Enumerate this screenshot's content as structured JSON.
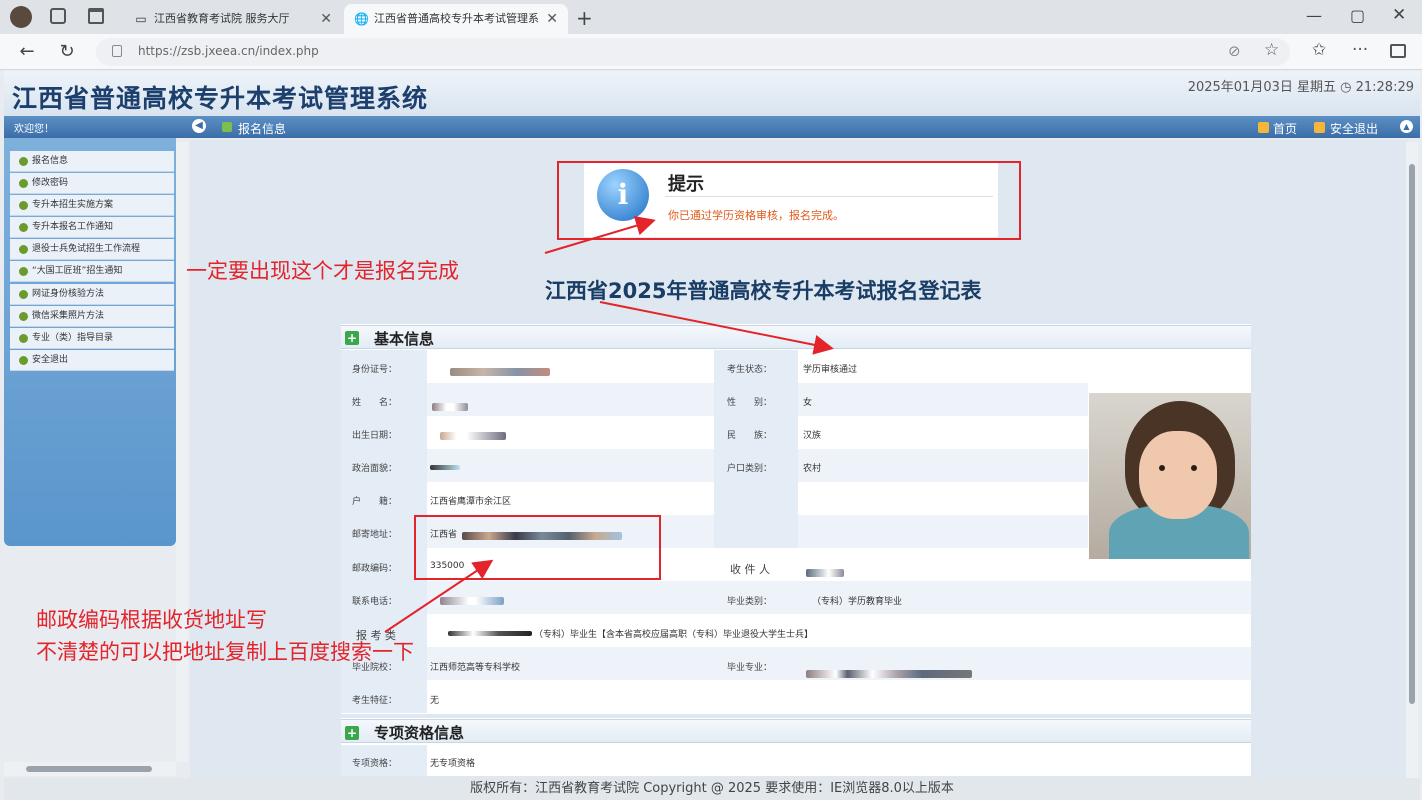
{
  "browser": {
    "tabs": [
      {
        "title": "江西省教育考试院 服务大厅",
        "active": false
      },
      {
        "title": "江西省普通高校专升本考试管理系",
        "active": true
      }
    ],
    "url": "https://zsb.jxeea.cn/index.php"
  },
  "header": {
    "title": "江西省普通高校专升本考试管理系统",
    "datetime": "2025年01月03日 星期五 ◷ 21:28:29"
  },
  "navbar": {
    "welcome": "欢迎您！",
    "breadcrumb": "报名信息",
    "home": "首页",
    "logout": "安全退出"
  },
  "sidebar": {
    "items": [
      {
        "label": "报名信息"
      },
      {
        "label": "修改密码"
      },
      {
        "label": "专升本招生实施方案"
      },
      {
        "label": "专升本报名工作通知"
      },
      {
        "label": "退役士兵免试招生工作流程"
      },
      {
        "label": "“大国工匠班”招生通知"
      },
      {
        "label": "网证身份核验方法"
      },
      {
        "label": "微信采集照片方法"
      },
      {
        "label": "专业（类）指导目录"
      },
      {
        "label": "安全退出"
      }
    ]
  },
  "notice": {
    "title": "提示",
    "message": "你已通过学历资格审核，报名完成。"
  },
  "annotations": {
    "notice": "一定要出现这个才是报名完成",
    "postal_line1": "邮政编码根据收货地址写",
    "postal_line2": "不清楚的可以把地址复制上百度搜索一下"
  },
  "form": {
    "title": "江西省2025年普通高校专升本考试报名登记表",
    "section_basic": "基本信息",
    "section_special": "专项资格信息",
    "labels": {
      "id_no": "身份证号：",
      "status": "考生状态：",
      "name": "姓　　名：",
      "gender": "性　　别：",
      "birth": "出生日期：",
      "ethnicity": "民　　族：",
      "politics": "政治面貌：",
      "hukou_type": "户口类别：",
      "hukou": "户　　籍：",
      "mail_addr": "邮寄地址：",
      "postal": "邮政编码：",
      "receiver": "收 件 人",
      "phone": "联系电话：",
      "grad_type": "毕业类别：",
      "type": "报 考 类",
      "school": "毕业院校：",
      "major": "毕业专业：",
      "feature": "考生特征：",
      "special": "专项资格："
    },
    "values": {
      "status": "学历审核通过",
      "gender": "女",
      "ethnicity": "汉族",
      "hukou_type": "农村",
      "hukou": "江西省鹰潭市余江区",
      "mail_addr_prefix": "江西省",
      "postal": "335000",
      "grad_type": "（专科）学历教育毕业",
      "type": "（专科）毕业生【含本省高校应届高职（专科）毕业退役大学生士兵】",
      "school": "江西师范高等专科学校",
      "feature": "无",
      "special": "无专项资格"
    }
  },
  "footer": {
    "text": "版权所有：江西省教育考试院 Copyright @ 2025 要求使用：IE浏览器8.0以上版本"
  },
  "colors": {
    "annotation_red": "#e3242b",
    "title_blue": "#1d3f6e",
    "notice_orange": "#e05a1c"
  }
}
